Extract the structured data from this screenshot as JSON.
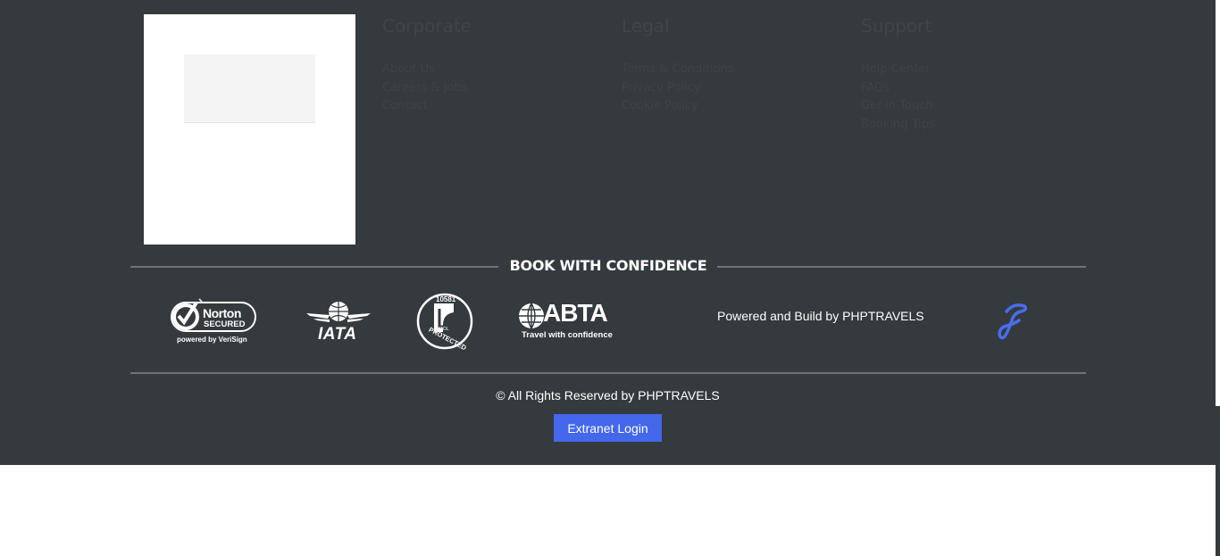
{
  "footer": {
    "columns": [
      {
        "title": "Corporate",
        "links": [
          "About Us",
          "Careers & Jobs",
          "Contact"
        ]
      },
      {
        "title": "Legal",
        "links": [
          "Terms & Conditions",
          "Privacy Policy",
          "Cookie Policy"
        ]
      },
      {
        "title": "Support",
        "links": [
          "Help Center",
          "FAQs",
          "Get in Touch",
          "Booking Tips"
        ]
      }
    ],
    "confidence_heading": "BOOK WITH CONFIDENCE",
    "badges": {
      "norton_word": "Norton",
      "norton_secured": "SECURED",
      "norton_powered": "powered by VeriSign",
      "iata": "IATA",
      "atol_number": "10581",
      "atol_word": "ATOL",
      "atol_protected": "PROTECTED",
      "abta": "ABTA",
      "abta_tagline": "Travel with confidence"
    },
    "powered_by": "Powered and Build by PHPTRAVELS",
    "copyright": "© All Rights Reserved by PHPTRAVELS",
    "extranet_login": "Extranet Login",
    "colors": {
      "footer_bg": "#343a3d",
      "button_bg": "#4467ec",
      "brand_icon": "#4a6cf0",
      "divider": "#6c7275"
    },
    "icons": [
      "norton-secured-logo",
      "iata-logo",
      "atol-protected-logo",
      "abta-logo",
      "phptravels-logo-icon"
    ]
  }
}
